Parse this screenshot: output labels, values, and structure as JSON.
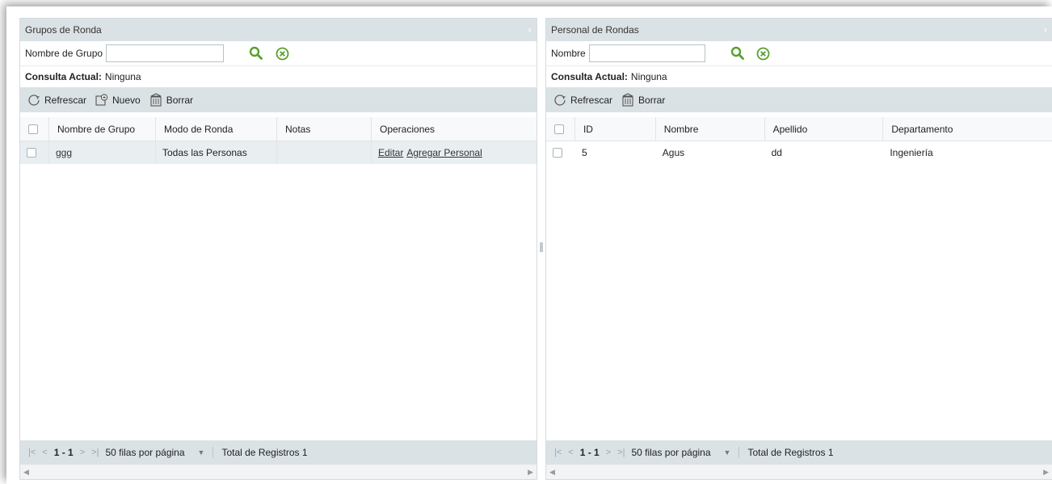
{
  "left": {
    "title": "Grupos de Ronda",
    "search_label": "Nombre de Grupo",
    "search_value": "",
    "query_label": "Consulta Actual:",
    "query_value": "Ninguna",
    "toolbar": {
      "refresh": "Refrescar",
      "new": "Nuevo",
      "delete": "Borrar"
    },
    "columns": [
      "Nombre de Grupo",
      "Modo de Ronda",
      "Notas",
      "Operaciones"
    ],
    "rows": [
      {
        "name": "ggg",
        "mode": "Todas las Personas",
        "notes": "",
        "op_edit": "Editar",
        "op_add": "Agregar Personal"
      }
    ],
    "pager": {
      "range": "1 - 1",
      "rows_per_page": "50 filas por página",
      "total": "Total de Registros 1"
    }
  },
  "right": {
    "title": "Personal de Rondas",
    "search_label": "Nombre",
    "search_value": "",
    "query_label": "Consulta Actual:",
    "query_value": "Ninguna",
    "toolbar": {
      "refresh": "Refrescar",
      "delete": "Borrar"
    },
    "columns": [
      "ID",
      "Nombre",
      "Apellido",
      "Departamento"
    ],
    "rows": [
      {
        "id": "5",
        "first": "Agus",
        "last": "dd",
        "dept": "Ingeniería"
      }
    ],
    "pager": {
      "range": "1 - 1",
      "rows_per_page": "50 filas por página",
      "total": "Total de Registros 1"
    }
  },
  "colors": {
    "accent_green": "#5aa02c",
    "header_bg": "#dbe2e5",
    "row_bg": "#e9eef1"
  },
  "icons": {
    "search": "search-icon",
    "clear": "clear-icon",
    "refresh": "refresh-icon",
    "new": "new-icon",
    "delete": "delete-icon"
  }
}
